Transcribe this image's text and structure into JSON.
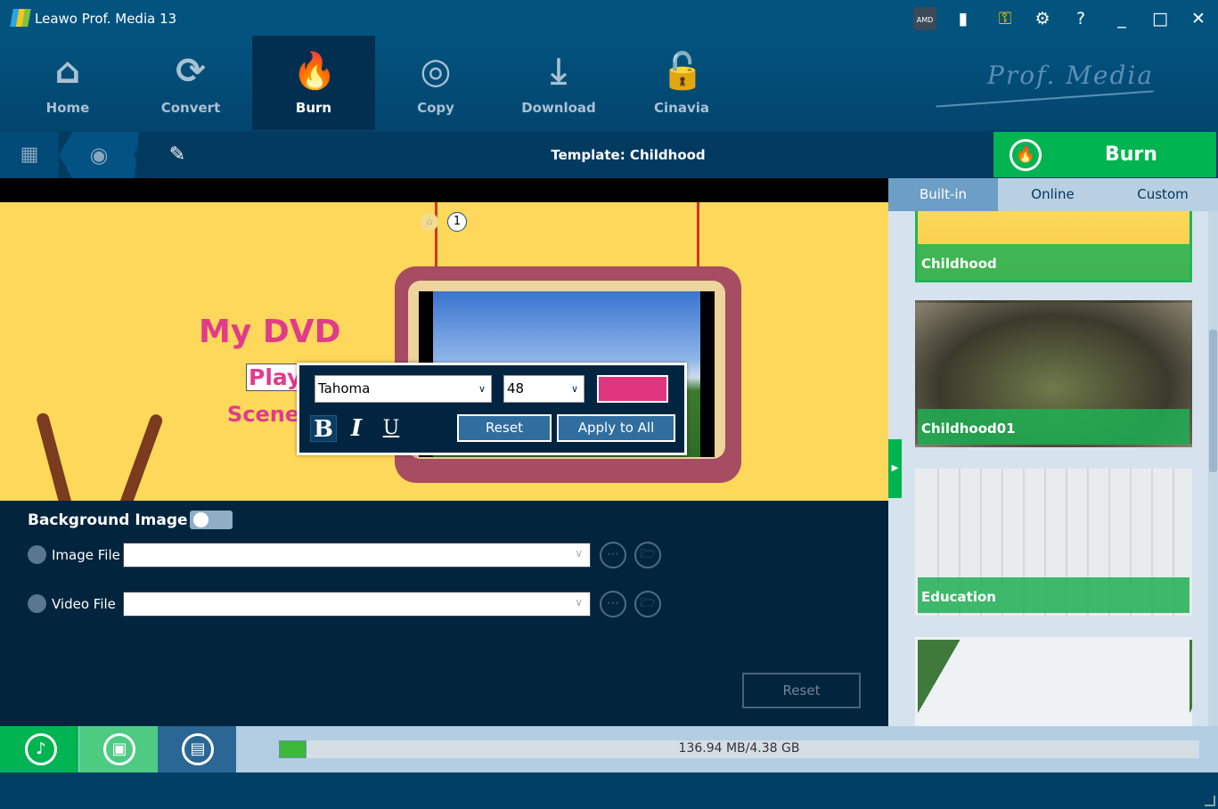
{
  "app": {
    "title": "Leawo Prof. Media 13",
    "brand": "Prof. Media"
  },
  "titlebar_icons": [
    "amd-badge-icon",
    "feedback-icon",
    "key-icon",
    "gear-icon",
    "help-icon",
    "minimize-icon",
    "maximize-icon",
    "close-icon"
  ],
  "nav": [
    {
      "label": "Home"
    },
    {
      "label": "Convert"
    },
    {
      "label": "Burn",
      "active": true
    },
    {
      "label": "Copy"
    },
    {
      "label": "Download"
    },
    {
      "label": "Cinavia"
    }
  ],
  "toolbar": {
    "template_label": "Template: Childhood",
    "burn_label": "Burn"
  },
  "preview": {
    "title": "My DVD",
    "play": "Play",
    "scene": "Scene",
    "chapter": "1"
  },
  "font_popup": {
    "font": "Tahoma",
    "size": "48",
    "color": "#e0357f",
    "bold": "B",
    "italic": "I",
    "underline": "U",
    "reset": "Reset",
    "apply_all": "Apply to All"
  },
  "background": {
    "label": "Background Image",
    "enabled": false,
    "image_file_label": "Image File",
    "image_file_value": "",
    "video_file_label": "Video File",
    "video_file_value": "",
    "reset": "Reset"
  },
  "templates": {
    "tabs": [
      "Built-in",
      "Online",
      "Custom"
    ],
    "active_tab": "Built-in",
    "items": [
      {
        "name": "Childhood"
      },
      {
        "name": "Childhood01"
      },
      {
        "name": "Education"
      },
      {
        "name": ""
      }
    ]
  },
  "footer": {
    "usage": "136.94 MB/4.38 GB",
    "progress_percent": 3
  }
}
